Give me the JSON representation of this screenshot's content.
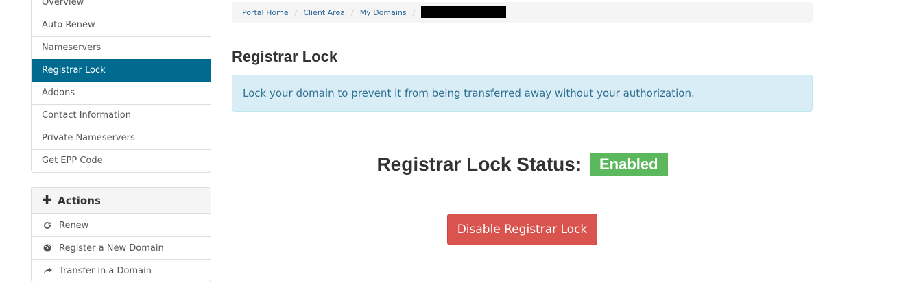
{
  "sidebar": {
    "items": [
      {
        "label": "Overview"
      },
      {
        "label": "Auto Renew"
      },
      {
        "label": "Nameservers"
      },
      {
        "label": "Registrar Lock",
        "active": true
      },
      {
        "label": "Addons"
      },
      {
        "label": "Contact Information"
      },
      {
        "label": "Private Nameservers"
      },
      {
        "label": "Get EPP Code"
      }
    ],
    "actions": {
      "title": "Actions",
      "icon": "plus-icon",
      "items": [
        {
          "label": "Renew",
          "icon": "refresh-icon"
        },
        {
          "label": "Register a New Domain",
          "icon": "globe-icon"
        },
        {
          "label": "Transfer in a Domain",
          "icon": "share-icon"
        }
      ]
    }
  },
  "breadcrumb": {
    "items": [
      "Portal Home",
      "Client Area",
      "My Domains"
    ],
    "redacted": true
  },
  "main": {
    "title": "Registrar Lock",
    "info": "Lock your domain to prevent it from being transferred away without your authorization.",
    "status_label": "Registrar Lock Status:",
    "status_value": "Enabled",
    "button_label": "Disable Registrar Lock"
  },
  "colors": {
    "active": "#006b8f",
    "success": "#5cb85c",
    "danger": "#d9534f",
    "info_bg": "#d9edf7"
  }
}
